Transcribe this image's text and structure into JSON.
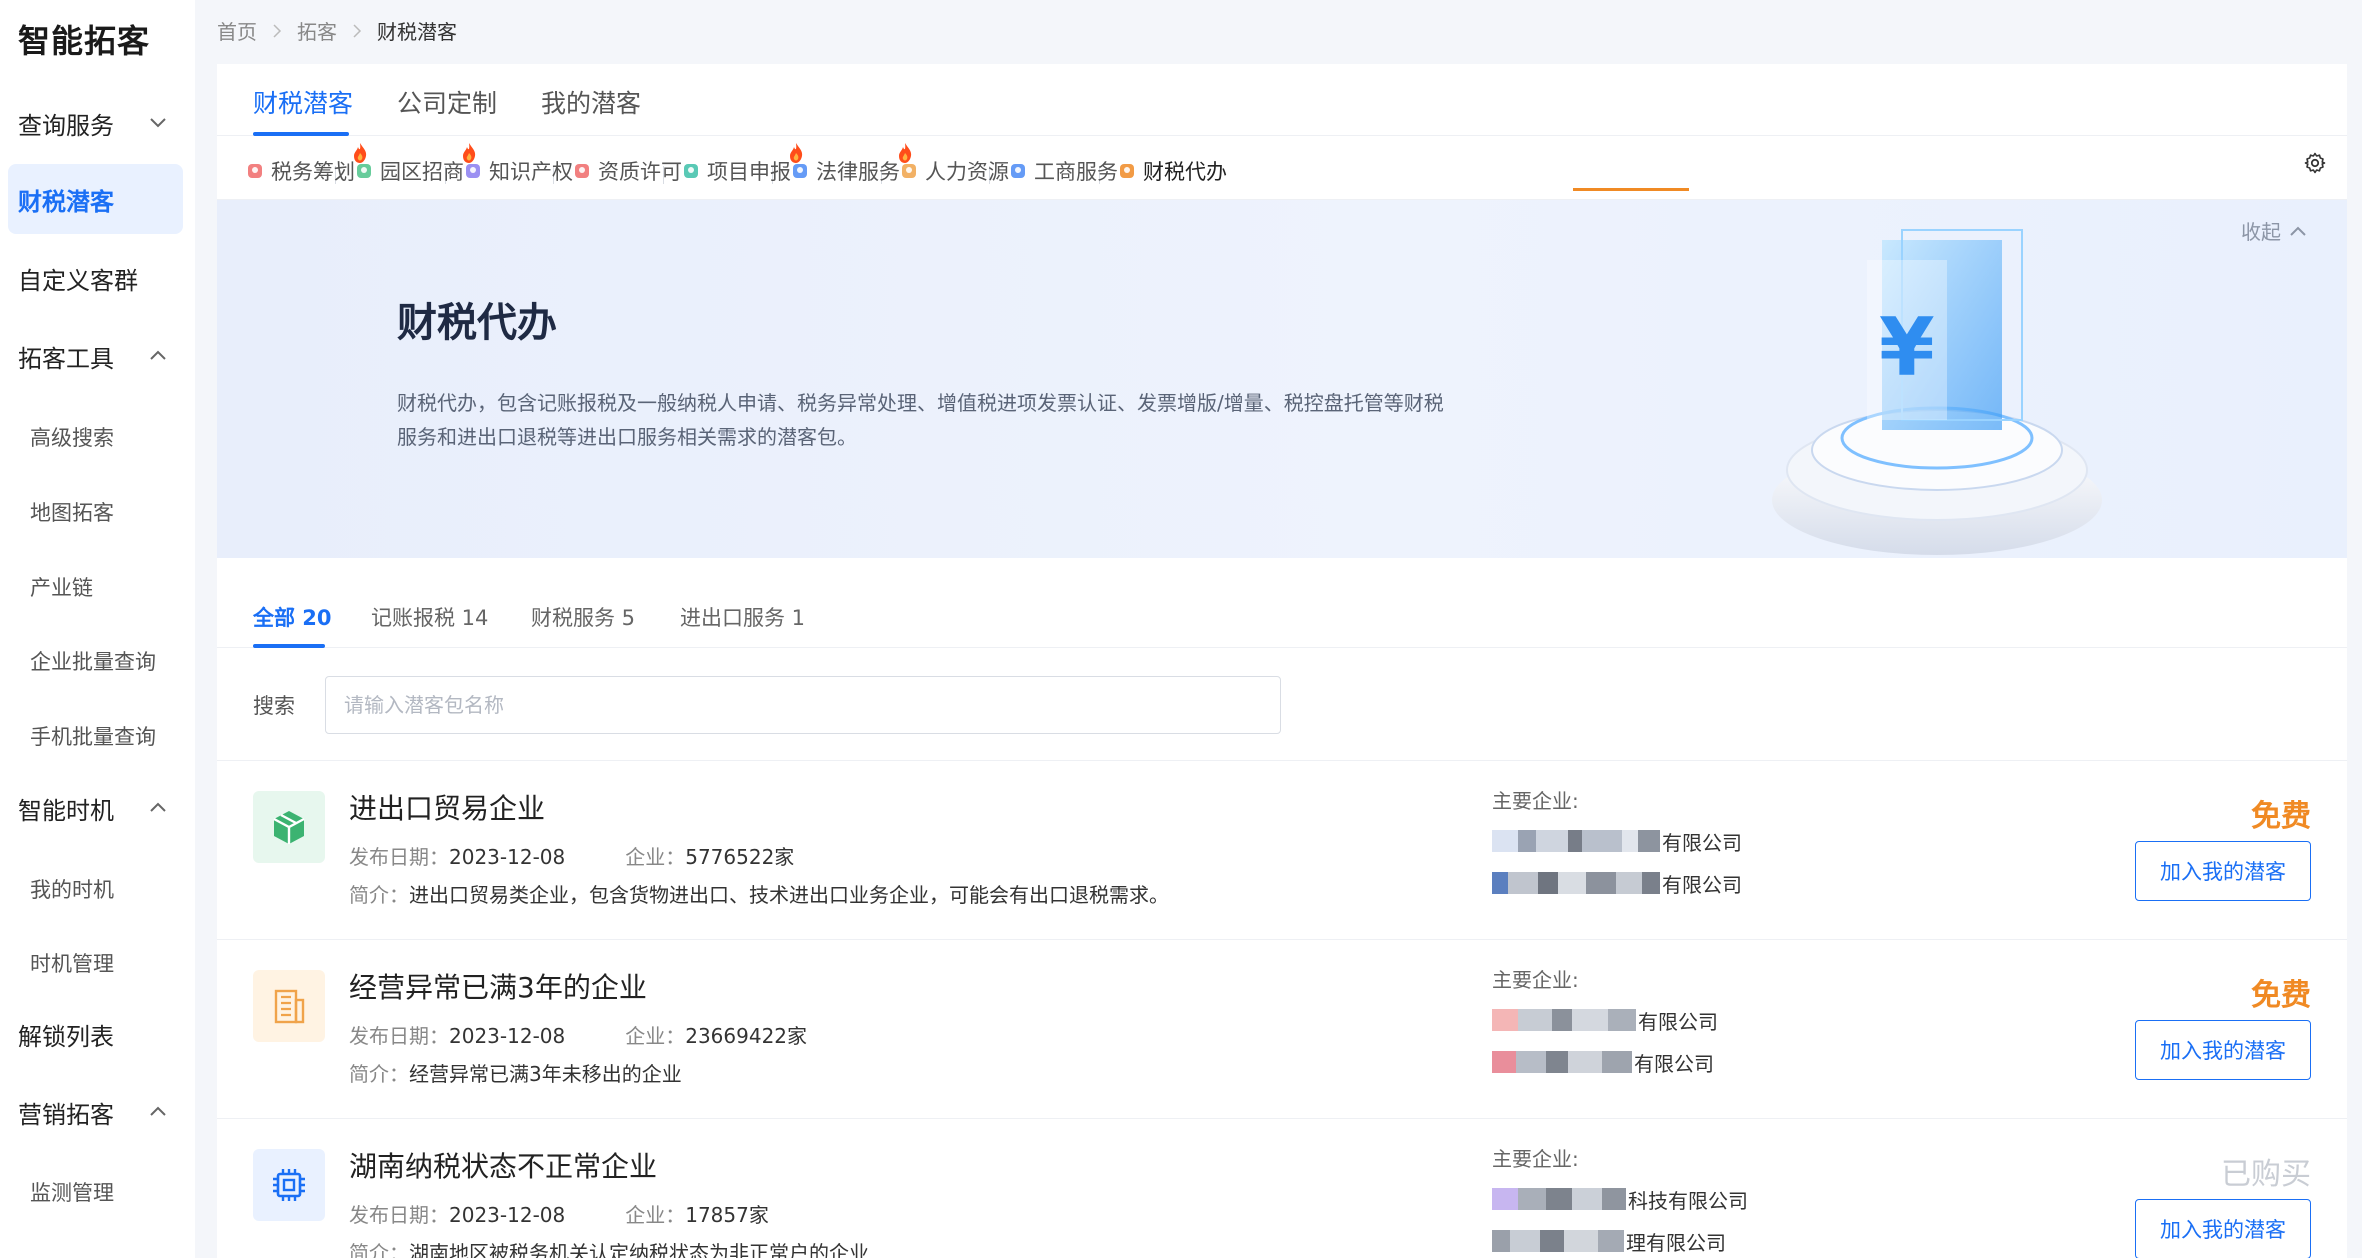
{
  "app": {
    "logo": "智能拓客"
  },
  "sidebar": {
    "items": [
      {
        "label": "查询服务",
        "type": "group",
        "expanded": false
      },
      {
        "label": "财税潜客",
        "type": "link",
        "active": true
      },
      {
        "label": "自定义客群",
        "type": "link"
      },
      {
        "label": "拓客工具",
        "type": "group",
        "expanded": true
      },
      {
        "label": "高级搜索",
        "type": "sub"
      },
      {
        "label": "地图拓客",
        "type": "sub"
      },
      {
        "label": "产业链",
        "type": "sub"
      },
      {
        "label": "企业批量查询",
        "type": "sub"
      },
      {
        "label": "手机批量查询",
        "type": "sub"
      },
      {
        "label": "智能时机",
        "type": "group",
        "expanded": true
      },
      {
        "label": "我的时机",
        "type": "sub"
      },
      {
        "label": "时机管理",
        "type": "sub"
      },
      {
        "label": "解锁列表",
        "type": "link"
      },
      {
        "label": "营销拓客",
        "type": "group",
        "expanded": true
      },
      {
        "label": "监测管理",
        "type": "sub"
      }
    ]
  },
  "breadcrumb": [
    "首页",
    "拓客",
    "财税潜客"
  ],
  "tabs": [
    {
      "label": "财税潜客",
      "active": true
    },
    {
      "label": "公司定制"
    },
    {
      "label": "我的潜客"
    }
  ],
  "categories": [
    {
      "label": "税务筹划",
      "icon": "tax-plan-icon",
      "color": "#f06a6a",
      "hot": true
    },
    {
      "label": "园区招商",
      "icon": "park-icon",
      "color": "#4cc38a",
      "hot": true
    },
    {
      "label": "知识产权",
      "icon": "ip-icon",
      "color": "#8a7cf0"
    },
    {
      "label": "资质许可",
      "icon": "license-icon",
      "color": "#f06a6a"
    },
    {
      "label": "项目申报",
      "icon": "project-icon",
      "color": "#3cbfa8",
      "hot": true
    },
    {
      "label": "法律服务",
      "icon": "law-icon",
      "color": "#4a8af4",
      "hot": true
    },
    {
      "label": "人力资源",
      "icon": "hr-icon",
      "color": "#f0a34a"
    },
    {
      "label": "工商服务",
      "icon": "business-icon",
      "color": "#4a8af4"
    },
    {
      "label": "财税代办",
      "icon": "finance-agent-icon",
      "color": "#f08a24",
      "active": true
    }
  ],
  "banner": {
    "title": "财税代办",
    "desc": "财税代办，包含记账报税及一般纳税人申请、税务异常处理、增值税进项发票认证、发票增版/增量、税控盘托管等财税服务和进出口退税等进出口服务相关需求的潜客包。",
    "collapse": "收起"
  },
  "subtabs": [
    {
      "label": "全部 20",
      "active": true
    },
    {
      "label": "记账报税 14"
    },
    {
      "label": "财税服务 5"
    },
    {
      "label": "进出口服务 1"
    }
  ],
  "search": {
    "label": "搜索",
    "placeholder": "请输入潜客包名称",
    "value": ""
  },
  "list": [
    {
      "title": "进出口贸易企业",
      "date_label": "发布日期：",
      "date": "2023-12-08",
      "count_label": "企业：",
      "count": "5776522家",
      "desc_label": "简介：",
      "desc": "进出口贸易类企业，包含货物进出口、技术进出口业务企业，可能会有出口退税需求。",
      "ents_label": "主要企业:",
      "ents": [
        "有限公司",
        "有限公司"
      ],
      "price": "免费",
      "price_type": "free",
      "btn": "加入我的潜客",
      "icon": "box-icon",
      "icon_bg": "#e7f7ee",
      "icon_color": "#3cb371"
    },
    {
      "title": "经营异常已满3年的企业",
      "date_label": "发布日期：",
      "date": "2023-12-08",
      "count_label": "企业：",
      "count": "23669422家",
      "desc_label": "简介：",
      "desc": "经营异常已满3年未移出的企业",
      "ents_label": "主要企业:",
      "ents": [
        "有限公司",
        "有限公司"
      ],
      "price": "免费",
      "price_type": "free",
      "btn": "加入我的潜客",
      "icon": "building-icon",
      "icon_bg": "#fff3e3",
      "icon_color": "#f0a34a"
    },
    {
      "title": "湖南纳税状态不正常企业",
      "date_label": "发布日期：",
      "date": "2023-12-08",
      "count_label": "企业：",
      "count": "17857家",
      "desc_label": "简介：",
      "desc": "湖南地区被税务机关认定纳税状态为非正常户的企业",
      "ents_label": "主要企业:",
      "ents": [
        "科技有限公司",
        "理有限公司"
      ],
      "price": "已购买",
      "price_type": "bought",
      "btn": "加入我的潜客",
      "icon": "chip-icon",
      "icon_bg": "#e9f1ff",
      "icon_color": "#1a6ff5"
    }
  ]
}
